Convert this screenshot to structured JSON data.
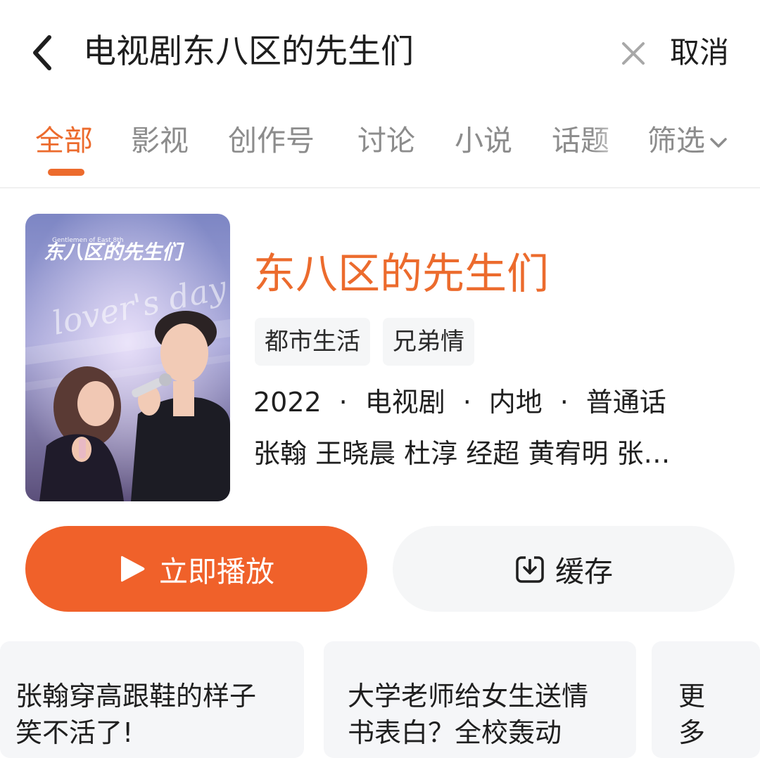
{
  "search": {
    "query": "电视剧东八区的先生们",
    "cancel_label": "取消"
  },
  "tabs": [
    {
      "label": "全部",
      "active": true
    },
    {
      "label": "影视",
      "active": false
    },
    {
      "label": "创作号",
      "active": false
    },
    {
      "label": "讨论",
      "active": false
    },
    {
      "label": "小说",
      "active": false
    },
    {
      "label": "话题",
      "active": false
    },
    {
      "label": "筛选",
      "active": false,
      "icon": "chevron-down-icon"
    }
  ],
  "result": {
    "poster": {
      "title_text": "东八区的先生们",
      "subtitle_text": "Gentlemen of East 8th",
      "script_text": "lover's day"
    },
    "title": "东八区的先生们",
    "tags": [
      "都市生活",
      "兄弟情"
    ],
    "meta": {
      "year": "2022",
      "type": "电视剧",
      "region": "内地",
      "language": "普通话",
      "separator": "·"
    },
    "cast": "张翰 王晓晨 杜淳 经超 黄宥明 张…"
  },
  "actions": {
    "play_label": "立即播放",
    "cache_label": "缓存"
  },
  "related": [
    {
      "lines": [
        "张翰穿高跟鞋的样子",
        "笑不活了!"
      ]
    },
    {
      "lines": [
        "大学老师给女生送情",
        "书表白？全校轰动"
      ]
    },
    {
      "lines": [
        "更",
        "多"
      ]
    }
  ],
  "colors": {
    "accent": "#ec6b2d",
    "play_button": "#f0612a",
    "muted_text": "#8c8c8c",
    "chip_bg": "#f5f6f7"
  }
}
